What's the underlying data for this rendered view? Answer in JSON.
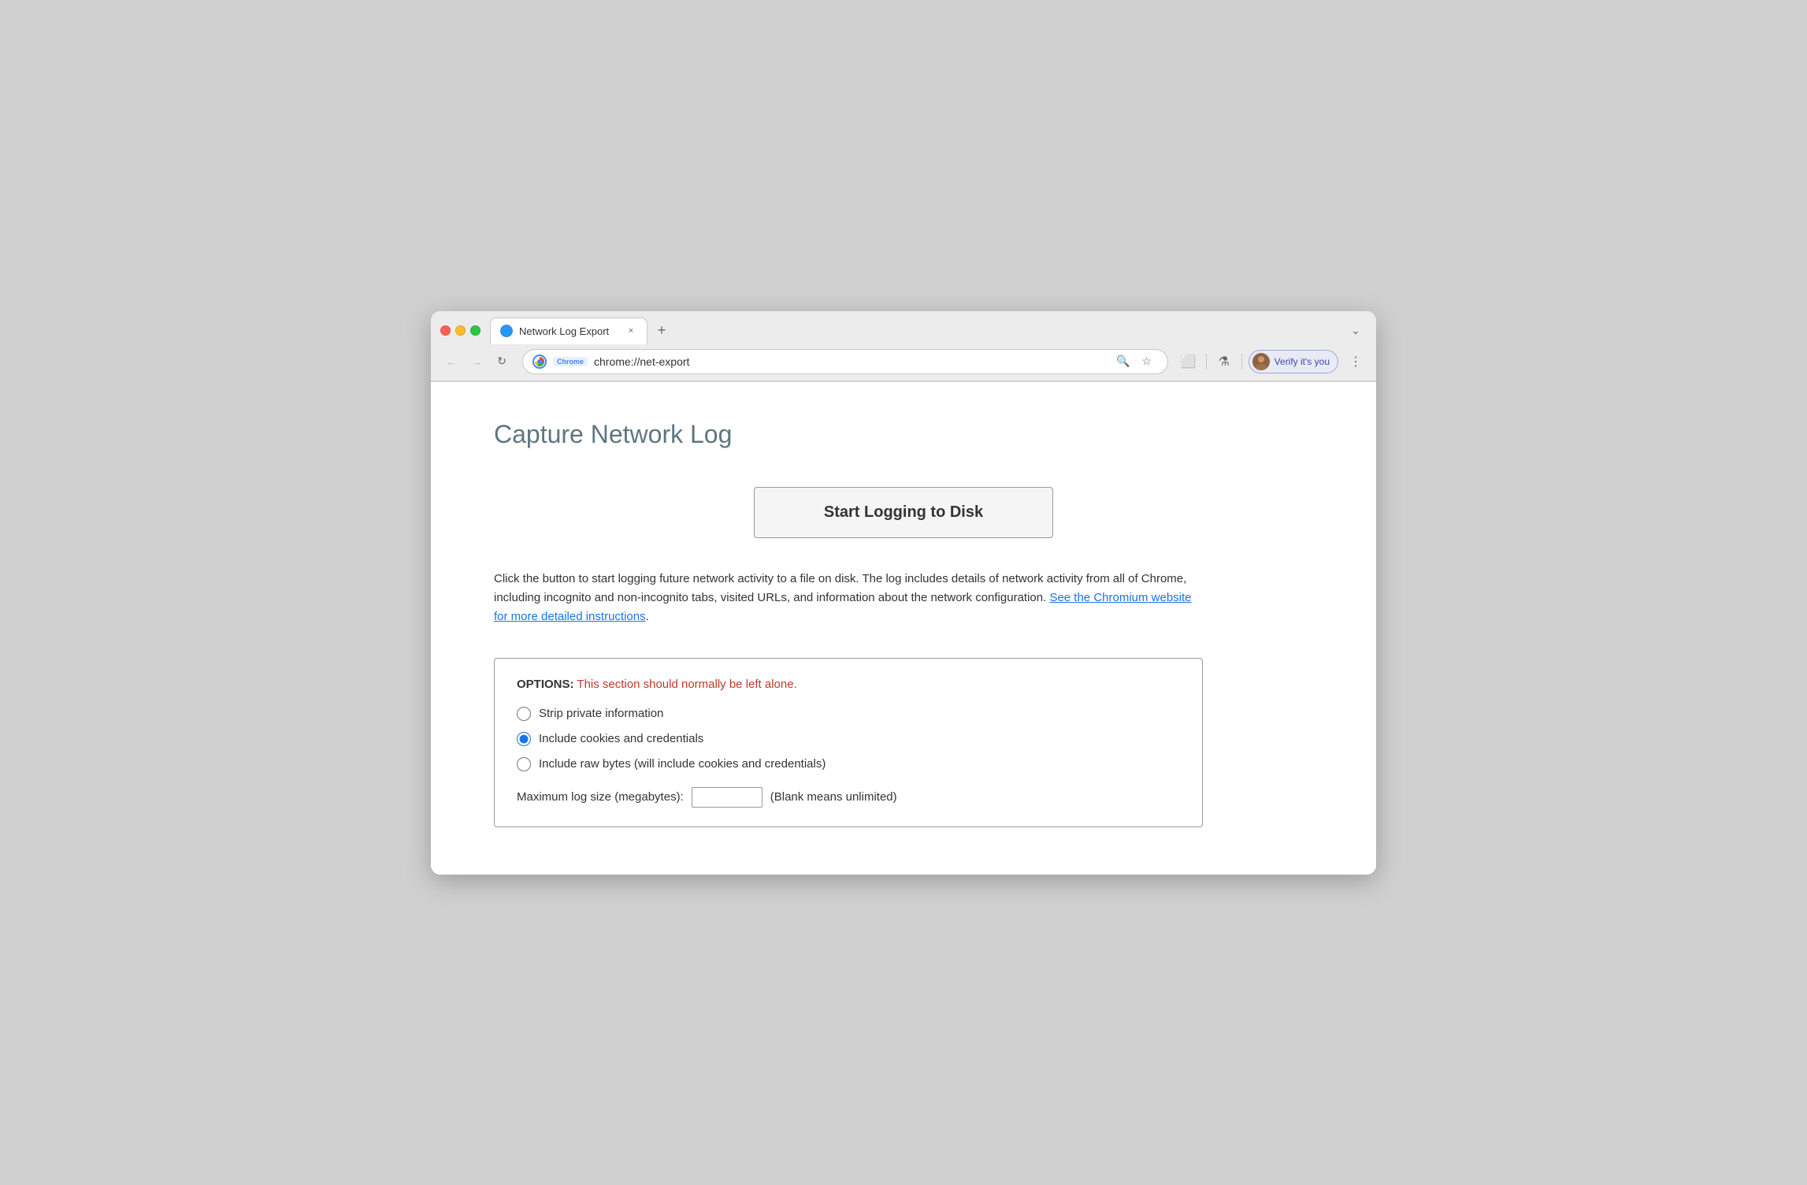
{
  "window": {
    "title": "Network Log Export",
    "tab_favicon": "🌐",
    "tab_close": "×",
    "new_tab": "+",
    "chevron": "⌄"
  },
  "nav": {
    "back_label": "←",
    "forward_label": "→",
    "reload_label": "↻",
    "chrome_badge": "Chrome",
    "url": "chrome://net-export",
    "search_icon": "🔍",
    "bookmark_icon": "☆",
    "extension_icon": "⬜",
    "lab_icon": "⚗",
    "profile_label": "Verify it's you",
    "menu_label": "⋮"
  },
  "page": {
    "title": "Capture Network Log",
    "start_button": "Start Logging to Disk",
    "description_text": "Click the button to start logging future network activity to a file on disk. The log includes details of network activity from all of Chrome, including incognito and non-incognito tabs, visited URLs, and information about the network configuration.",
    "link_text": "See the Chromium website for more detailed instructions",
    "options_label": "OPTIONS:",
    "options_warning": "This section should normally be left alone.",
    "radio1_label": "Strip private information",
    "radio2_label": "Include cookies and credentials",
    "radio3_label": "Include raw bytes (will include cookies and credentials)",
    "max_log_label": "Maximum log size (megabytes):",
    "max_log_placeholder": "",
    "max_log_suffix": "(Blank means unlimited)"
  }
}
